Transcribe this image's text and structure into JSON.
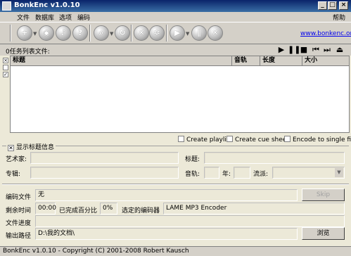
{
  "window": {
    "title": "BonkEnc v1.0.10",
    "controls": [
      "_",
      "□",
      "×"
    ]
  },
  "menu": [
    "文件",
    "数据库",
    "选项",
    "编码"
  ],
  "help_menu": "帮助",
  "toolbar": {
    "icons": [
      "add-files-icon",
      "cd-rip-icon",
      "cd-info-icon",
      "cddb-query-icon",
      "search-icon",
      "refresh-icon",
      "tools-icon",
      "settings-icon",
      "encode-icon",
      "pause-icon",
      "stop-icon"
    ],
    "homepage": "www.bonkenc.org"
  },
  "joblist": {
    "count_label": "0任务列表文件:",
    "columns": [
      "标题",
      "音轨",
      "长度",
      "大小"
    ],
    "side_icons": [
      "×",
      "",
      "✓"
    ]
  },
  "options": {
    "create_playlist": "Create playlist",
    "create_cue_sheet": "Create cue sheet",
    "encode_single_file": "Encode to single file"
  },
  "info": {
    "legend": "显示标题信息",
    "artist": "艺术家:",
    "title": "标题:",
    "album": "专辑:",
    "track": "音轨:",
    "year": "年:",
    "genre": "流派:"
  },
  "status": {
    "encoding_file_label": "编码文件",
    "encoding_file_value": "无",
    "skip": "Skip",
    "time_left_label": "剩余时间",
    "time_left_value": "00:00",
    "percent_label": "已完成百分比",
    "percent_value": "0%",
    "encoder_label": "选定的编码器",
    "encoder_value": "LAME MP3 Encoder",
    "file_progress_label": "文件进度",
    "output_label": "输出路径",
    "output_value": "D:\\我的文档\\",
    "browse": "浏览"
  },
  "statusbar": "BonkEnc v1.0.10 - Copyright (C) 2001-2008 Robert Kausch",
  "colors": {
    "titlebar": "#0a246a",
    "face": "#d4d0c8",
    "window": "#ece9d8",
    "link": "#0000ee"
  }
}
